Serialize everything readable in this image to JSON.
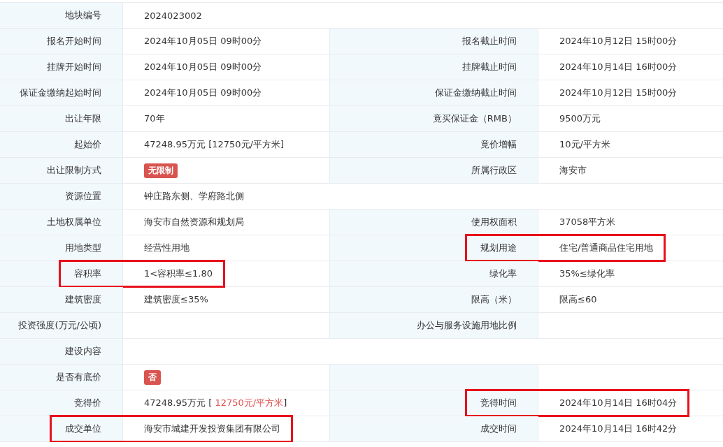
{
  "rows": [
    {
      "kind": "full",
      "cells": [
        {
          "label": "地块编号",
          "value": "2024023002",
          "kind": "text",
          "highlighted": false
        }
      ]
    },
    {
      "kind": "split",
      "cells": [
        {
          "label": "报名开始时间",
          "value": "2024年10月05日 09时00分",
          "kind": "text",
          "highlighted": false
        },
        {
          "label": "报名截止时间",
          "value": "2024年10月12日 15时00分",
          "kind": "text",
          "highlighted": false
        }
      ]
    },
    {
      "kind": "split",
      "cells": [
        {
          "label": "挂牌开始时间",
          "value": "2024年10月05日 09时00分",
          "kind": "text",
          "highlighted": false
        },
        {
          "label": "挂牌截止时间",
          "value": "2024年10月14日 16时00分",
          "kind": "text",
          "highlighted": false
        }
      ]
    },
    {
      "kind": "split",
      "cells": [
        {
          "label": "保证金缴纳起始时间",
          "value": "2024年10月05日 09时00分",
          "kind": "text",
          "highlighted": false
        },
        {
          "label": "保证金缴纳截止时间",
          "value": "2024年10月12日 15时00分",
          "kind": "text",
          "highlighted": false
        }
      ]
    },
    {
      "kind": "split",
      "cells": [
        {
          "label": "出让年限",
          "value": "70年",
          "kind": "text",
          "highlighted": false
        },
        {
          "label": "竟买保证金（RMB）",
          "value": "9500万元",
          "kind": "text",
          "highlighted": false
        }
      ]
    },
    {
      "kind": "split",
      "cells": [
        {
          "label": "起始价",
          "value": "47248.95万元 [12750元/平方米]",
          "kind": "text",
          "highlighted": false
        },
        {
          "label": "竟价增幅",
          "value": "10元/平方米",
          "kind": "text",
          "highlighted": false
        }
      ]
    },
    {
      "kind": "split",
      "cells": [
        {
          "label": "出让限制方式",
          "value": "无限制",
          "kind": "badge",
          "highlighted": false
        },
        {
          "label": "所属行政区",
          "value": "海安市",
          "kind": "text",
          "highlighted": false
        }
      ]
    },
    {
      "kind": "full",
      "cells": [
        {
          "label": "资源位置",
          "value": "钟庄路东侧、学府路北侧",
          "kind": "text",
          "highlighted": false
        }
      ]
    },
    {
      "kind": "split",
      "cells": [
        {
          "label": "土地权属单位",
          "value": "海安市自然资源和规划局",
          "kind": "text",
          "highlighted": false
        },
        {
          "label": "使用权面积",
          "value": "37058平方米",
          "kind": "text",
          "highlighted": false
        }
      ]
    },
    {
      "kind": "split",
      "cells": [
        {
          "label": "用地类型",
          "value": "经营性用地",
          "kind": "text",
          "highlighted": false
        },
        {
          "label": "规划用途",
          "value": "住宅/普通商品住宅用地",
          "kind": "text",
          "highlighted": true
        }
      ]
    },
    {
      "kind": "split",
      "cells": [
        {
          "label": "容积率",
          "value": "1<容积率≤1.80",
          "kind": "text",
          "highlighted": true
        },
        {
          "label": "绿化率",
          "value": "35%≤绿化率",
          "kind": "text",
          "highlighted": false
        }
      ]
    },
    {
      "kind": "split",
      "cells": [
        {
          "label": "建筑密度",
          "value": "建筑密度≤35%",
          "kind": "text",
          "highlighted": false
        },
        {
          "label": "限高（米）",
          "value": "限高≤60",
          "kind": "text",
          "highlighted": false
        }
      ]
    },
    {
      "kind": "split",
      "cells": [
        {
          "label": "投资强度(万元/公顷)",
          "kind": "text",
          "highlighted": false
        },
        {
          "label": "办公与服务设施用地比例",
          "kind": "text",
          "highlighted": false
        }
      ]
    },
    {
      "kind": "full",
      "cells": [
        {
          "label": "建设内容",
          "kind": "text",
          "highlighted": false
        }
      ]
    },
    {
      "kind": "split",
      "cells": [
        {
          "label": "是否有底价",
          "value": "否",
          "kind": "badge",
          "highlighted": false
        }
      ]
    },
    {
      "kind": "split",
      "cells": [
        {
          "label": "竞得价",
          "kind": "price",
          "text_before": "47248.95万元 [ ",
          "text_emphasis": "12750元/平方米",
          "text_after": "]",
          "highlighted": false
        },
        {
          "label": "竞得时间",
          "value": "2024年10月14日 16时04分",
          "kind": "text",
          "highlighted": true
        }
      ]
    },
    {
      "kind": "split",
      "cells": [
        {
          "label": "成交单位",
          "value": "海安市城建开发投资集团有限公司",
          "kind": "text",
          "highlighted": true
        },
        {
          "label": "成交时间",
          "value": "2024年10月14日 16时42分",
          "kind": "text",
          "highlighted": false
        }
      ]
    }
  ]
}
